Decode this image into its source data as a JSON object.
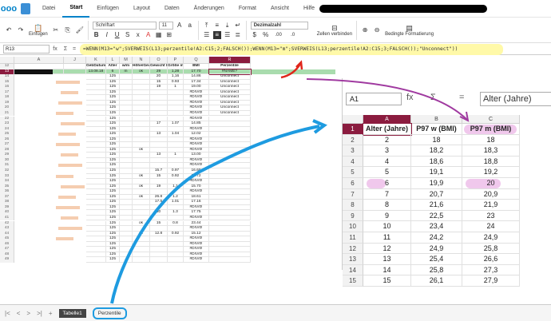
{
  "topbar": {
    "logo": "ooo",
    "menu": [
      "Datei",
      "Start",
      "Einfügen",
      "Layout",
      "Daten",
      "Änderungen",
      "Format",
      "Ansicht",
      "Hilfe"
    ],
    "active": "Start"
  },
  "toolbar": {
    "paste_label": "Einfügen",
    "font_name": "Schriftart",
    "font_size": "11",
    "number_format": "Dezimalzahl",
    "merge_label": "Zellen verbinden",
    "conditional_label": "Bedingte Formatierung",
    "percent": "%",
    "currency": "$",
    "decimals_more": ".00",
    "decimals_less": ".0"
  },
  "formula_bar": {
    "cell_ref": "R13",
    "fx": "fx",
    "sigma": "Σ",
    "eq": "=",
    "formula": "=WENN(M13=\"w\";SVERWEIS(L13;perzentile!A2:C15;2;FALSCH());WENN(M13=\"m\";SVERWEIS(L13;perzentile!A2:C15;3;FALSCH());\"Unconnect\"))"
  },
  "sheet": {
    "columns": [
      {
        "id": "A",
        "label": "A"
      },
      {
        "id": "J",
        "label": "J"
      },
      {
        "id": "K",
        "label": "K"
      },
      {
        "id": "L",
        "label": "L"
      },
      {
        "id": "M",
        "label": "M"
      },
      {
        "id": "N",
        "label": "N"
      },
      {
        "id": "O",
        "label": "O"
      },
      {
        "id": "P",
        "label": "P"
      },
      {
        "id": "Q",
        "label": "Q"
      },
      {
        "id": "R",
        "label": "R"
      }
    ],
    "header_row": [
      "GebDatum",
      "Alter",
      "w/m",
      "Höhe/Gewicht",
      "Gewicht kg",
      "Größe m",
      "BMI",
      "Perzentile"
    ],
    "rows": [
      {
        "n": "12",
        "k": "GebDatum",
        "l": "Alter",
        "m": "w/m",
        "n2": "Höhe/Gewicht",
        "o": "Gewicht kg",
        "p": "Größe m",
        "q": "BMI",
        "r": "Perzentile"
      },
      {
        "n": "13",
        "k": "13.08.18",
        "l": "6",
        "m": "m",
        "n2": "ok",
        "o": "29",
        "p": "1,28",
        "q": "17.70",
        "r": "#NAME?"
      },
      {
        "n": "14",
        "k": "",
        "l": "125",
        "m": "",
        "n2": "",
        "o": "20",
        "p": "1,16",
        "q": "14.86",
        "r": "Unconnect"
      },
      {
        "n": "15",
        "k": "",
        "l": "125",
        "m": "",
        "n2": "",
        "o": "15",
        "p": "0.93",
        "q": "17.34",
        "r": "Unconnect"
      },
      {
        "n": "16",
        "k": "",
        "l": "125",
        "m": "",
        "n2": "",
        "o": "19",
        "p": "1",
        "q": "19.00",
        "r": "Unconnect"
      },
      {
        "n": "17",
        "k": "",
        "l": "125",
        "m": "",
        "n2": "",
        "o": "",
        "p": "",
        "q": "#DIV/0!",
        "r": "Unconnect"
      },
      {
        "n": "18",
        "k": "",
        "l": "125",
        "m": "",
        "n2": "",
        "o": "",
        "p": "",
        "q": "#DIV/0!",
        "r": "Unconnect"
      },
      {
        "n": "19",
        "k": "",
        "l": "125",
        "m": "",
        "n2": "",
        "o": "",
        "p": "",
        "q": "#DIV/0!",
        "r": "Unconnect"
      },
      {
        "n": "20",
        "k": "",
        "l": "125",
        "m": "",
        "n2": "",
        "o": "",
        "p": "",
        "q": "#DIV/0!",
        "r": "Unconnect"
      },
      {
        "n": "21",
        "k": "",
        "l": "125",
        "m": "",
        "n2": "",
        "o": "",
        "p": "",
        "q": "#DIV/0!",
        "r": "Unconnect"
      },
      {
        "n": "22",
        "k": "",
        "l": "125",
        "m": "",
        "n2": "",
        "o": "",
        "p": "",
        "q": "#DIV/0!",
        "r": ""
      },
      {
        "n": "23",
        "k": "",
        "l": "125",
        "m": "",
        "n2": "",
        "o": "17",
        "p": "1.07",
        "q": "14.85",
        "r": ""
      },
      {
        "n": "24",
        "k": "",
        "l": "125",
        "m": "",
        "n2": "",
        "o": "",
        "p": "",
        "q": "#DIV/0!",
        "r": ""
      },
      {
        "n": "25",
        "k": "",
        "l": "125",
        "m": "",
        "n2": "",
        "o": "13",
        "p": "1.04",
        "q": "12.02",
        "r": ""
      },
      {
        "n": "26",
        "k": "",
        "l": "125",
        "m": "",
        "n2": "",
        "o": "",
        "p": "",
        "q": "#DIV/0!",
        "r": ""
      },
      {
        "n": "27",
        "k": "",
        "l": "125",
        "m": "",
        "n2": "",
        "o": "",
        "p": "",
        "q": "#DIV/0!",
        "r": ""
      },
      {
        "n": "28",
        "k": "",
        "l": "125",
        "m": "",
        "n2": "ok",
        "o": "",
        "p": "",
        "q": "#DIV/0!",
        "r": ""
      },
      {
        "n": "29",
        "k": "",
        "l": "125",
        "m": "",
        "n2": "",
        "o": "13",
        "p": "1",
        "q": "13.00",
        "r": ""
      },
      {
        "n": "30",
        "k": "",
        "l": "125",
        "m": "",
        "n2": "",
        "o": "",
        "p": "",
        "q": "#DIV/0!",
        "r": ""
      },
      {
        "n": "31",
        "k": "",
        "l": "125",
        "m": "",
        "n2": "",
        "o": "",
        "p": "",
        "q": "#DIV/0!",
        "r": ""
      },
      {
        "n": "32",
        "k": "",
        "l": "125",
        "m": "",
        "n2": "",
        "o": "15.7",
        "p": "0.97",
        "q": "16.69",
        "r": ""
      },
      {
        "n": "33",
        "k": "",
        "l": "125",
        "m": "",
        "n2": "ok",
        "o": "15",
        "p": "0.92",
        "q": "17.72",
        "r": ""
      },
      {
        "n": "34",
        "k": "",
        "l": "125",
        "m": "",
        "n2": "",
        "o": "",
        "p": "",
        "q": "#DIV/0!",
        "r": ""
      },
      {
        "n": "35",
        "k": "",
        "l": "125",
        "m": "",
        "n2": "ok",
        "o": "19",
        "p": "1,1",
        "q": "15.70",
        "r": ""
      },
      {
        "n": "36",
        "k": "",
        "l": "125",
        "m": "",
        "n2": "",
        "o": "",
        "p": "",
        "q": "#DIV/0!",
        "r": ""
      },
      {
        "n": "37",
        "k": "",
        "l": "125",
        "m": "",
        "n2": "ok",
        "o": "26.8",
        "p": "1.2",
        "q": "18.61",
        "r": ""
      },
      {
        "n": "38",
        "k": "",
        "l": "125",
        "m": "",
        "n2": "",
        "o": "17.5",
        "p": "1.01",
        "q": "17.16",
        "r": ""
      },
      {
        "n": "39",
        "k": "",
        "l": "125",
        "m": "",
        "n2": "",
        "o": "",
        "p": "",
        "q": "#DIV/0!",
        "r": ""
      },
      {
        "n": "40",
        "k": "",
        "l": "125",
        "m": "",
        "n2": "",
        "o": "30",
        "p": "1.3",
        "q": "17.75",
        "r": ""
      },
      {
        "n": "41",
        "k": "",
        "l": "125",
        "m": "",
        "n2": "",
        "o": "",
        "p": "",
        "q": "#DIV/0!",
        "r": ""
      },
      {
        "n": "42",
        "k": "",
        "l": "125",
        "m": "",
        "n2": "ok",
        "o": "15",
        "p": "0.8",
        "q": "23.44",
        "r": ""
      },
      {
        "n": "43",
        "k": "",
        "l": "125",
        "m": "",
        "n2": "",
        "o": "",
        "p": "",
        "q": "#DIV/0!",
        "r": ""
      },
      {
        "n": "44",
        "k": "",
        "l": "125",
        "m": "",
        "n2": "ok",
        "o": "12.8",
        "p": "0.92",
        "q": "15.12",
        "r": ""
      },
      {
        "n": "45",
        "k": "",
        "l": "125",
        "m": "",
        "n2": "",
        "o": "",
        "p": "",
        "q": "#DIV/0!",
        "r": ""
      },
      {
        "n": "46",
        "k": "",
        "l": "125",
        "m": "",
        "n2": "",
        "o": "",
        "p": "",
        "q": "#DIV/0!",
        "r": ""
      },
      {
        "n": "47",
        "k": "",
        "l": "125",
        "m": "",
        "n2": "",
        "o": "",
        "p": "",
        "q": "#DIV/0!",
        "r": ""
      },
      {
        "n": "48",
        "k": "",
        "l": "125",
        "m": "",
        "n2": "",
        "o": "",
        "p": "",
        "q": "#DIV/0!",
        "r": ""
      },
      {
        "n": "49",
        "k": "",
        "l": "125",
        "m": "",
        "n2": "",
        "o": "",
        "p": "",
        "q": "#DIV/0!",
        "r": ""
      }
    ]
  },
  "zoom_panel": {
    "cell_ref": "A1",
    "fx": "fx",
    "sigma": "Σ",
    "eq": "=",
    "formula": "Alter (Jahre)",
    "columns": [
      "A",
      "B",
      "C"
    ],
    "headers": [
      "Alter (Jahre)",
      "P97 w (BMI)",
      "P97 m (BMI)"
    ],
    "rows": [
      [
        "2",
        "18",
        "18"
      ],
      [
        "3",
        "18,2",
        "18,3"
      ],
      [
        "4",
        "18,6",
        "18,8"
      ],
      [
        "5",
        "19,1",
        "19,2"
      ],
      [
        "6",
        "19,9",
        "20"
      ],
      [
        "7",
        "20,7",
        "20,9"
      ],
      [
        "8",
        "21,6",
        "21,9"
      ],
      [
        "9",
        "22,5",
        "23"
      ],
      [
        "10",
        "23,4",
        "24"
      ],
      [
        "11",
        "24,2",
        "24,9"
      ],
      [
        "12",
        "24,9",
        "25,8"
      ],
      [
        "13",
        "25,4",
        "26,6"
      ],
      [
        "14",
        "25,8",
        "27,3"
      ],
      [
        "15",
        "26,1",
        "27,9"
      ]
    ]
  },
  "bottombar": {
    "tabs": [
      "Tabelle1",
      "Perzentile"
    ],
    "add": "+"
  },
  "colors": {
    "accent": "#8b1c3f",
    "arrow_red": "#e0261b",
    "arrow_purple": "#a03aa0",
    "arrow_blue": "#1e9be0",
    "highlight_yellow": "#fff9a8",
    "highlight_pink": "#f0c8ec",
    "row_green": "#a9dcae"
  }
}
